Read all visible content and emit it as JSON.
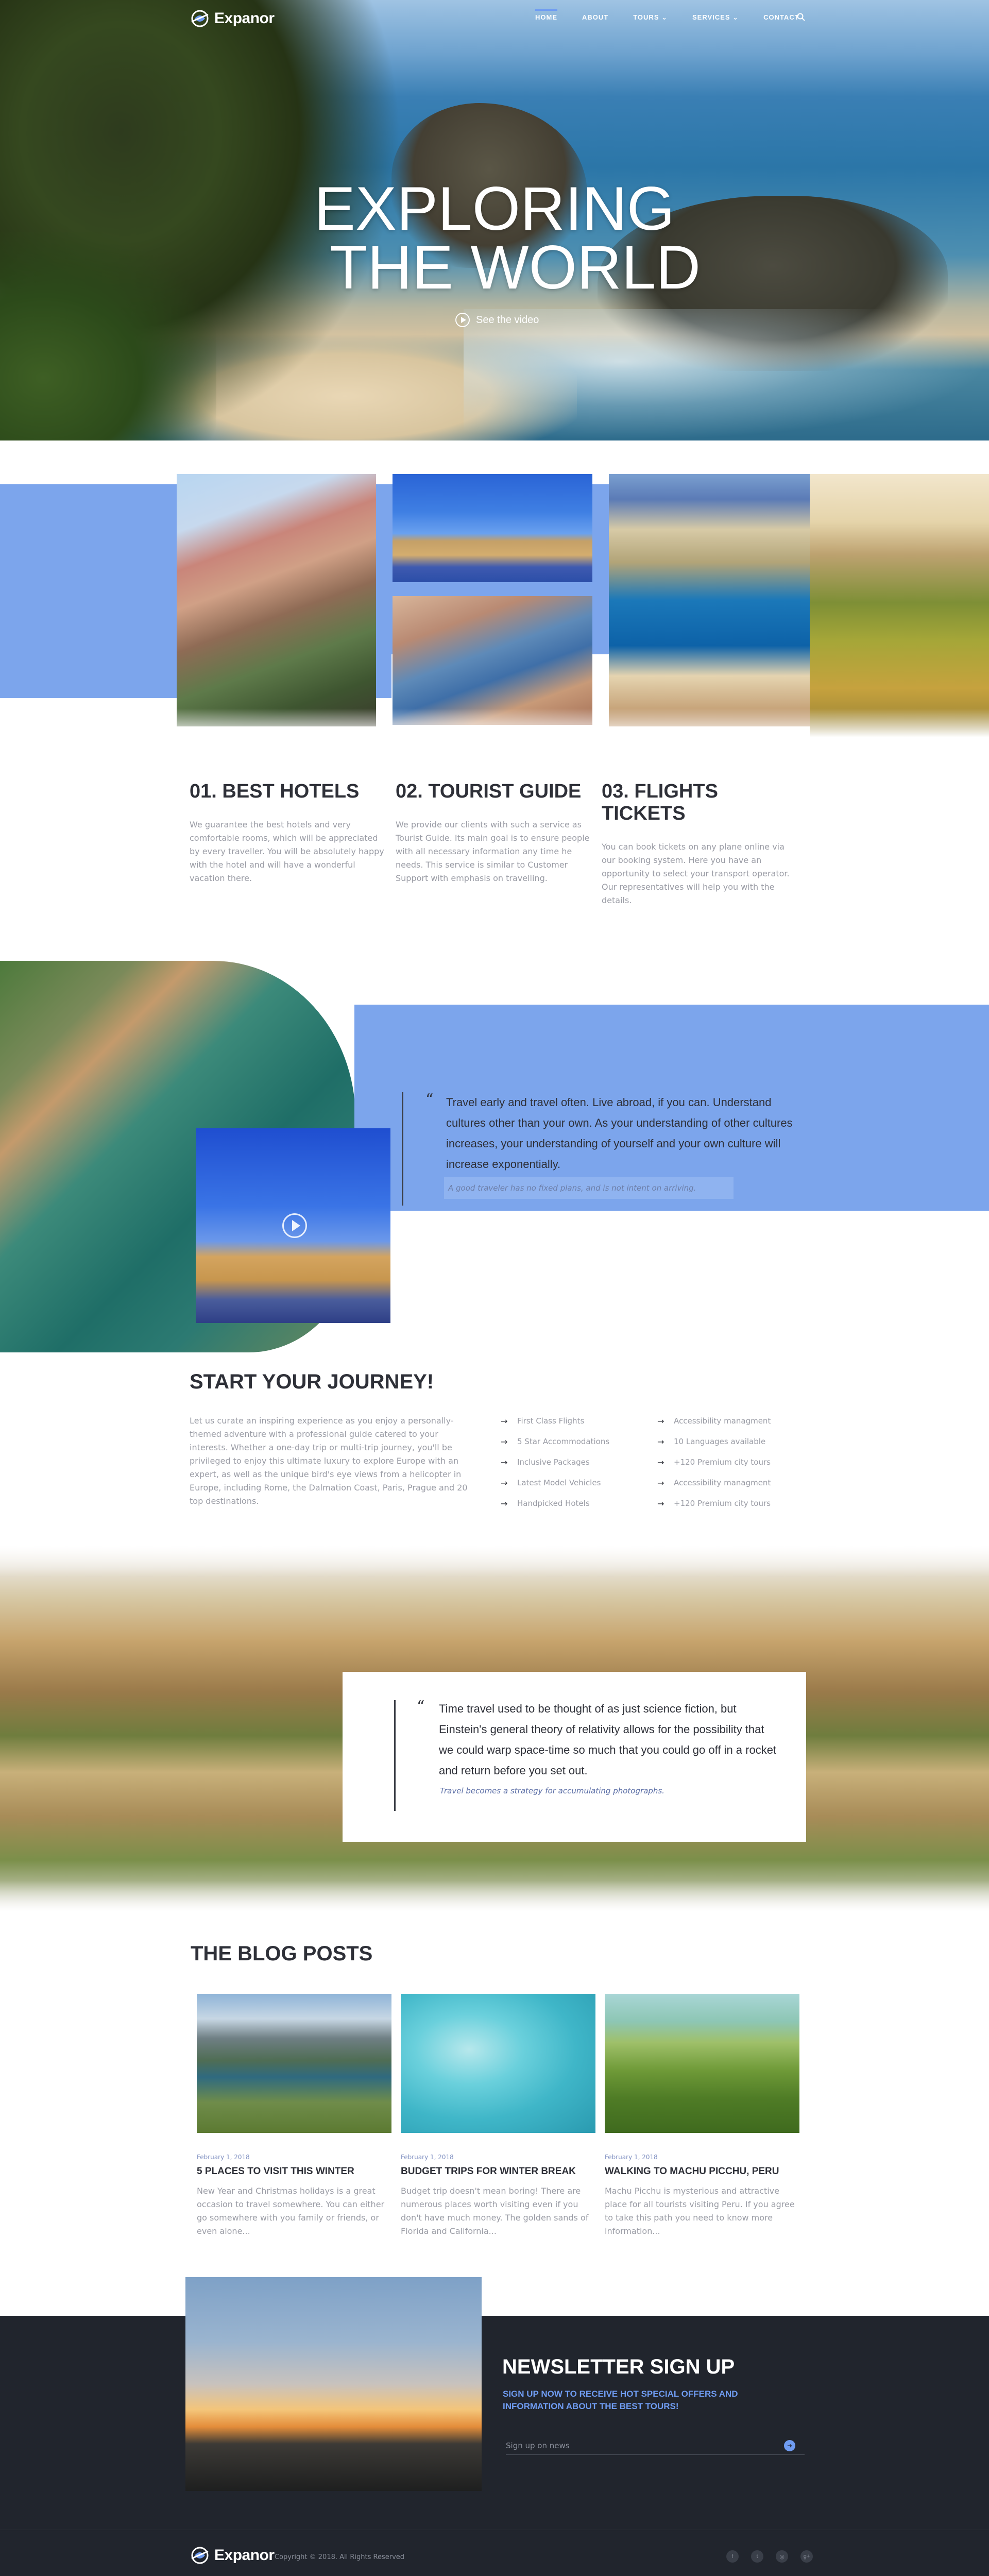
{
  "brand": {
    "name": "Expanor"
  },
  "nav": {
    "items": [
      {
        "label": "HOME",
        "has_dropdown": false,
        "active": true
      },
      {
        "label": "ABOUT",
        "has_dropdown": false,
        "active": false
      },
      {
        "label": "TOURS",
        "has_dropdown": true,
        "active": false
      },
      {
        "label": "SERVICES",
        "has_dropdown": true,
        "active": false
      },
      {
        "label": "CONTACT",
        "has_dropdown": false,
        "active": false
      }
    ],
    "search_icon": "search-icon"
  },
  "hero": {
    "title_line1": "EXPLORING",
    "title_line2": "THE WORLD",
    "video_label": "See the video"
  },
  "services": [
    {
      "title": "01. BEST HOTELS",
      "text": "We guarantee the best hotels and very comfortable rooms, which will be appreciated by every traveller. You will be absolutely happy with the hotel and will have a wonderful vacation there."
    },
    {
      "title": "02. TOURIST GUIDE",
      "text": "We provide our clients with such a service as Tourist Guide. Its main goal is to ensure people with all necessary information any time he needs. This service is similar to Customer Support with emphasis on travelling."
    },
    {
      "title": "03. FLIGHTS TICKETS",
      "text": "You can book tickets on any plane online via our booking system. Here you have an opportunity to select your transport operator. Our representatives will help you with the details."
    }
  ],
  "quote1": {
    "text": "Travel early and travel often. Live abroad, if you can. Understand cultures other than your own. As your understanding of other cultures increases, your understanding of yourself and your own culture will increase exponentially.",
    "sub": "A good traveler has no fixed plans, and is not intent on arriving."
  },
  "journey": {
    "title": "START YOUR JOURNEY!",
    "text": "Let us curate an inspiring experience as you enjoy a personally-themed adventure with a professional guide catered to your interests. Whether a one-day trip or multi-trip journey, you'll be privileged to enjoy this ultimate luxury to explore Europe with an expert, as well as the unique bird's eye views from a helicopter in Europe, including Rome, the Dalmation Coast, Paris, Prague and 20 top destinations.",
    "features_col1": [
      "First Class Flights",
      "5 Star Accommodations",
      "Inclusive Packages",
      "Latest Model Vehicles",
      "Handpicked Hotels"
    ],
    "features_col2": [
      "Accessibility managment",
      "10 Languages available",
      "+120 Premium city tours",
      "Accessibility managment",
      "+120 Premium city tours"
    ]
  },
  "quote2": {
    "text": "Time travel used to be thought of as just science fiction, but Einstein's general theory of relativity allows for the possibility that we could warp space-time so much that you could go off in a rocket and return before you set out.",
    "sub": "Travel becomes a strategy for accumulating photographs."
  },
  "blog": {
    "heading": "THE BLOG POSTS",
    "posts": [
      {
        "date": "February 1, 2018",
        "title": "5 PLACES TO VISIT THIS WINTER",
        "text": "New Year and Christmas holidays is a great occasion to travel somewhere. You can either go somewhere with you family or friends, or even alone..."
      },
      {
        "date": "February 1, 2018",
        "title": "BUDGET TRIPS FOR WINTER BREAK",
        "text": "Budget trip doesn't mean boring! There are numerous places worth visiting even if you don't have much money. The golden sands of Florida and California..."
      },
      {
        "date": "February 1, 2018",
        "title": "WALKING TO MACHU PICCHU, PERU",
        "text": "Machu Picchu is mysterious and attractive place for all tourists visiting Peru. If you agree to take this path you need to know more information..."
      }
    ]
  },
  "newsletter": {
    "title": "NEWSLETTER SIGN UP",
    "subtitle": "SIGN UP NOW TO RECEIVE HOT SPECIAL OFFERS AND INFORMATION ABOUT THE BEST TOURS!",
    "placeholder": "Sign up on news"
  },
  "footer": {
    "copyright": "Copyright © 2018. All Rights Reserved",
    "social_icons": [
      "facebook-icon",
      "twitter-icon",
      "instagram-icon",
      "google-plus-icon"
    ],
    "social_glyphs": [
      "f",
      "t",
      "◎",
      "g+"
    ]
  },
  "colors": {
    "accent": "#6f9cf2",
    "panel_blue": "#7ca5ec",
    "dark": "#21252d"
  }
}
